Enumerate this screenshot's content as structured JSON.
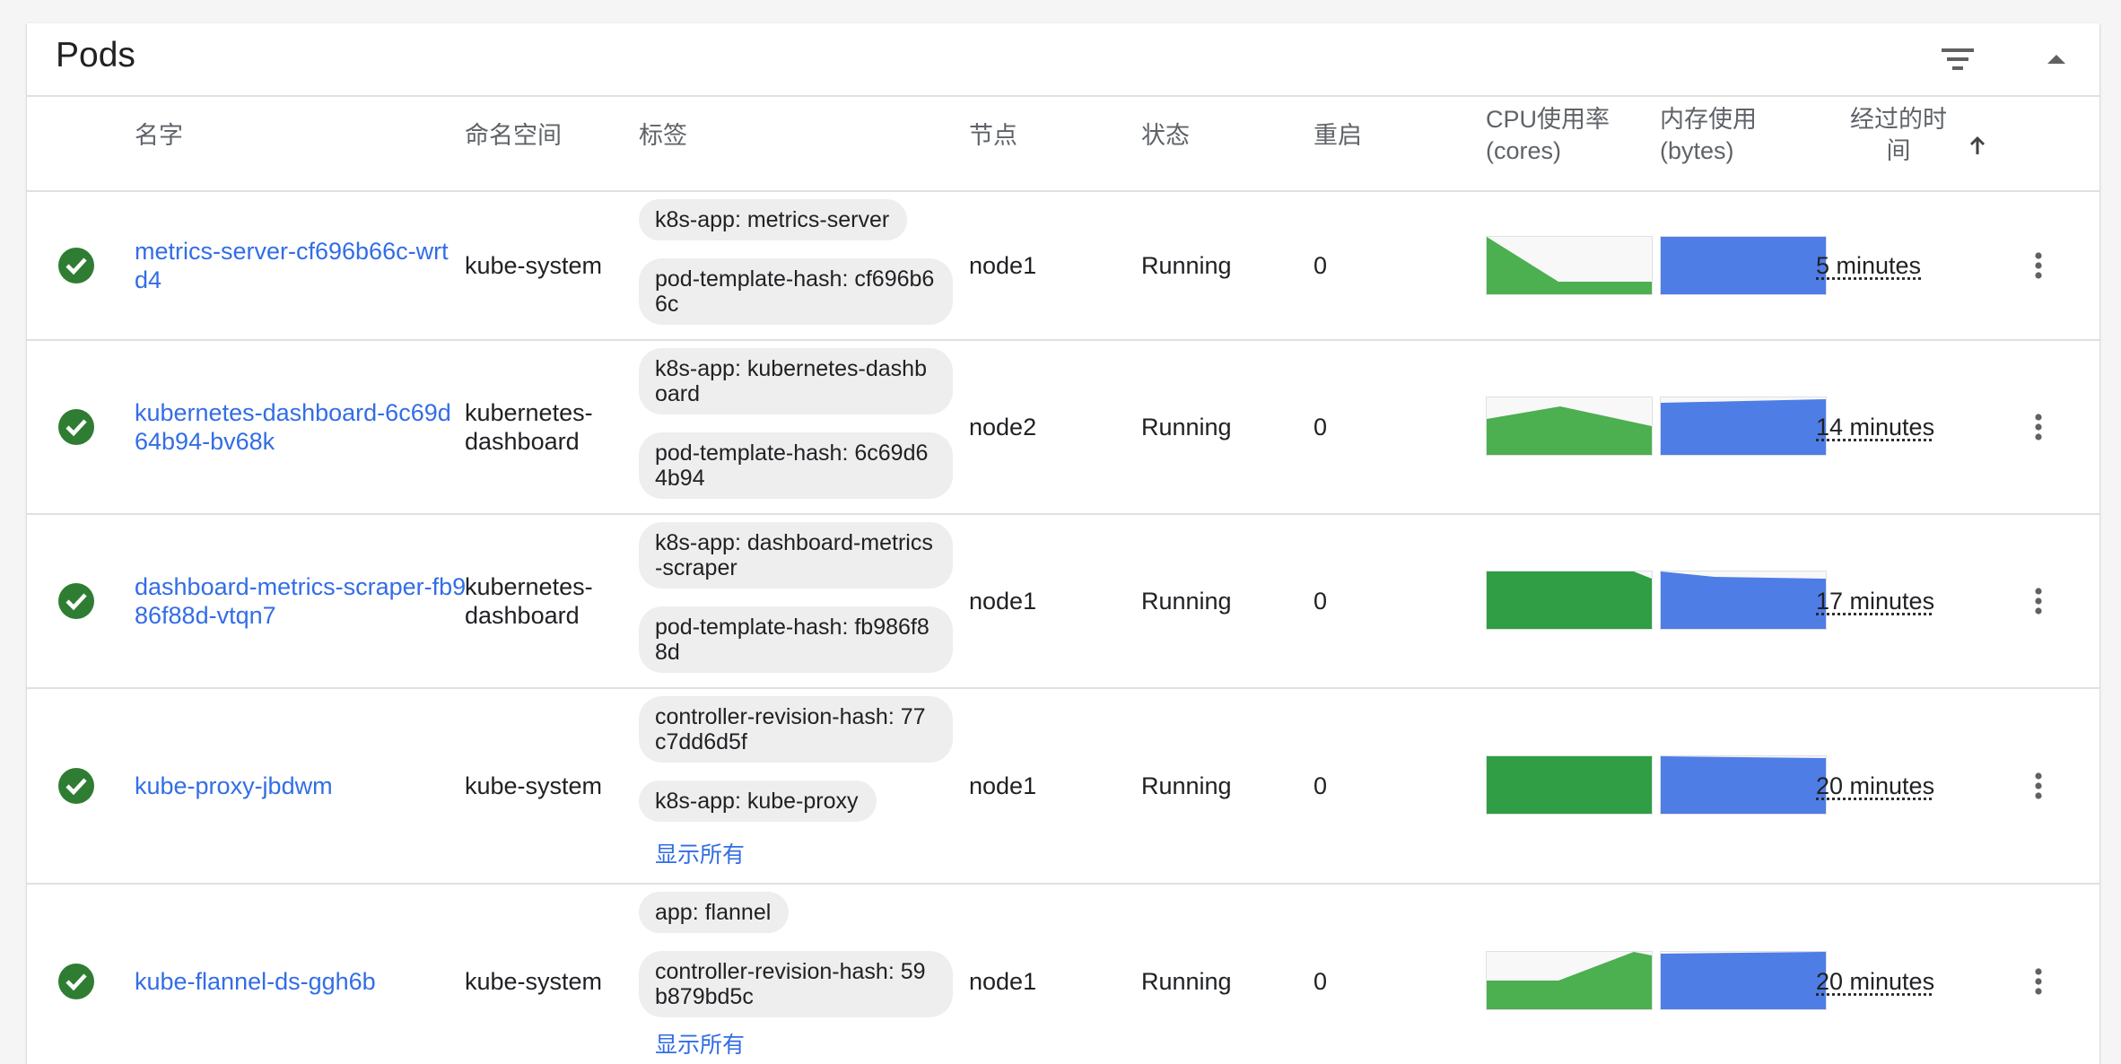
{
  "card": {
    "title": "Pods",
    "filter_icon": "filter-list-icon",
    "collapse_icon": "expand-less-icon"
  },
  "columns": {
    "name": "名字",
    "namespace": "命名空间",
    "labels": "标签",
    "node": "节点",
    "status": "状态",
    "restarts": "重启",
    "cpu_line1": "CPU使用率",
    "cpu_line2": "(cores)",
    "mem_line1": "内存使用",
    "mem_line2": "(bytes)",
    "age_line1": "经过的时",
    "age_line2": "间",
    "sort_icon": "arrow-upward-icon"
  },
  "colors": {
    "link": "#326de6",
    "status_ok": "#2e7d32",
    "cpu_fill": "#4caf50",
    "mem_fill": "#4f7de6"
  },
  "show_all": "显示所有",
  "pods": [
    {
      "name": "metrics-server-cf696b66c-wrtd4",
      "namespace": "kube-system",
      "labels": [
        "k8s-app: metrics-server",
        "pod-template-hash: cf696b66c"
      ],
      "node": "node1",
      "status": "Running",
      "restarts": "0",
      "age": "5 minutes"
    },
    {
      "name": "kubernetes-dashboard-6c69d64b94-bv68k",
      "namespace": "kubernetes-dashboard",
      "labels": [
        "k8s-app: kubernetes-dashboard",
        "pod-template-hash: 6c69d64b94"
      ],
      "node": "node2",
      "status": "Running",
      "restarts": "0",
      "age": "14 minutes"
    },
    {
      "name": "dashboard-metrics-scraper-fb986f88d-vtqn7",
      "namespace": "kubernetes-dashboard",
      "labels": [
        "k8s-app: dashboard-metrics-scraper",
        "pod-template-hash: fb986f88d"
      ],
      "node": "node1",
      "status": "Running",
      "restarts": "0",
      "age": "17 minutes"
    },
    {
      "name": "kube-proxy-jbdwm",
      "namespace": "kube-system",
      "labels": [
        "controller-revision-hash: 77c7dd6d5f",
        "k8s-app: kube-proxy"
      ],
      "node": "node1",
      "status": "Running",
      "restarts": "0",
      "age": "20 minutes"
    },
    {
      "name": "kube-flannel-ds-ggh6b",
      "namespace": "kube-system",
      "labels": [
        "app: flannel",
        "controller-revision-hash: 59b879bd5c"
      ],
      "node": "node1",
      "status": "Running",
      "restarts": "0",
      "age": "20 minutes"
    }
  ]
}
